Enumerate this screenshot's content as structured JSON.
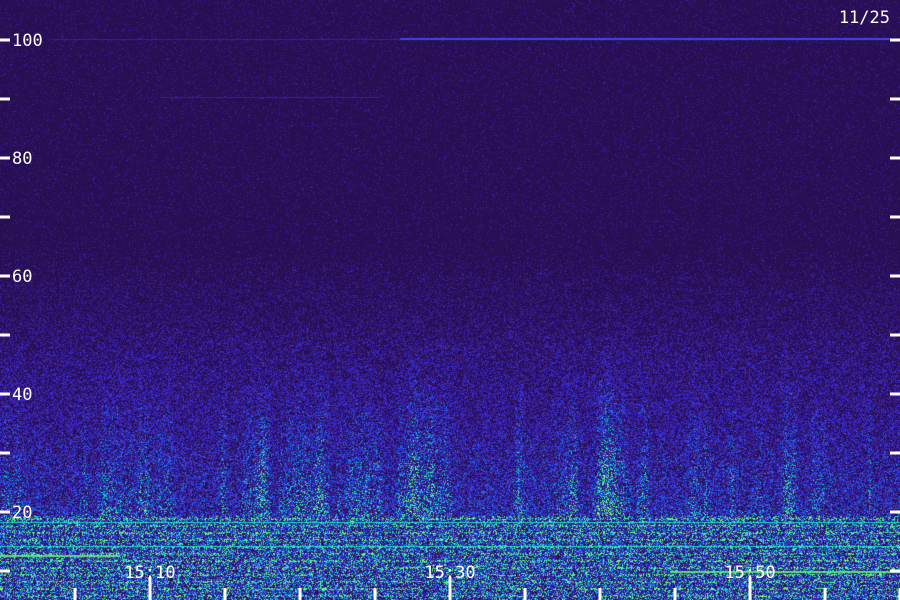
{
  "chart_data": {
    "type": "heatmap",
    "date_label": "11/25",
    "y_ticks": [
      100,
      80,
      60,
      40,
      20
    ],
    "y_minor_ticks": [
      90,
      70,
      50,
      30,
      10
    ],
    "ylim": [
      10,
      100
    ],
    "x_labels": [
      "15:10",
      "15:30",
      "15:50"
    ],
    "x_range_minutes": [
      "15:07",
      "15:67"
    ],
    "x_tick_minutes": [
      "15:05",
      "15:10",
      "15:15",
      "15:20",
      "15:25",
      "15:30",
      "15:35",
      "15:40",
      "15:45",
      "15:50",
      "15:55",
      "15:60",
      "15:65"
    ],
    "colors": {
      "background": "#2a0f52",
      "mid": "#3a2bd8",
      "high": "#19e0c8",
      "peak": "#6cff7a",
      "axis": "#ffffff"
    }
  }
}
